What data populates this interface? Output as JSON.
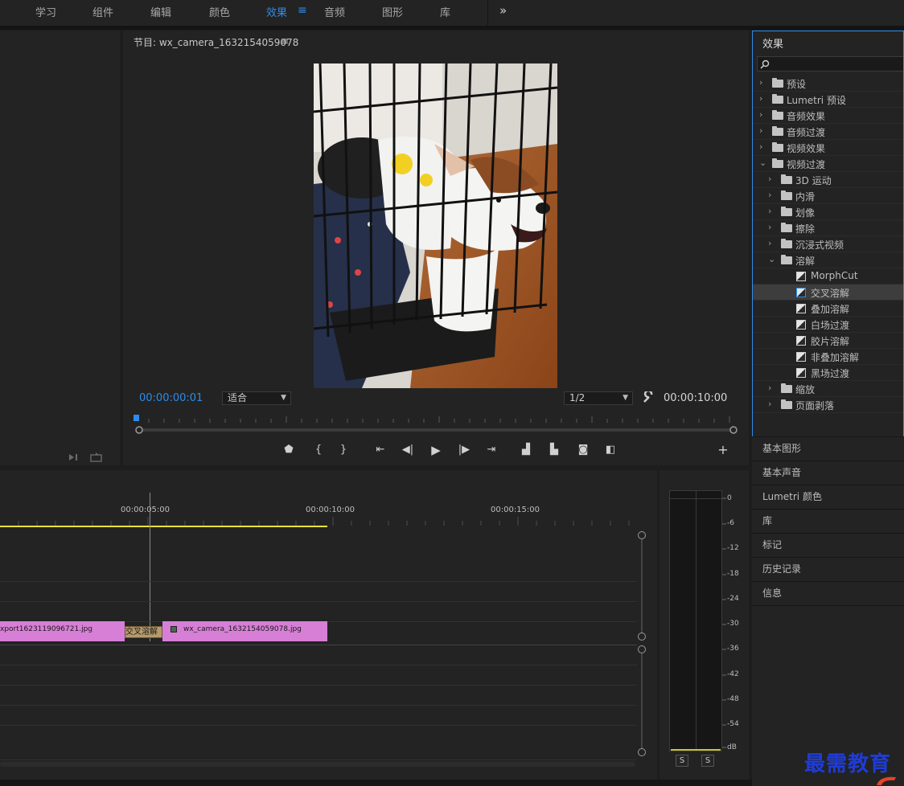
{
  "workspace_tabs": [
    "学习",
    "组件",
    "编辑",
    "颜色",
    "效果",
    "音频",
    "图形",
    "库"
  ],
  "active_tab": "效果",
  "program_monitor": {
    "title": "节目: wx_camera_1632154059078",
    "timecode_current": "00:00:00:01",
    "fit": "适合",
    "resolution": "1/2",
    "timecode_duration": "00:00:10:00"
  },
  "effects_panel": {
    "title": "效果",
    "search_placeholder": "",
    "tree": [
      {
        "label": "预设",
        "level": 0,
        "kind": "folder-star",
        "expanded": false
      },
      {
        "label": "Lumetri 预设",
        "level": 0,
        "kind": "folder-star",
        "expanded": false
      },
      {
        "label": "音频效果",
        "level": 0,
        "kind": "folder",
        "expanded": false
      },
      {
        "label": "音频过渡",
        "level": 0,
        "kind": "folder",
        "expanded": false
      },
      {
        "label": "视频效果",
        "level": 0,
        "kind": "folder",
        "expanded": false
      },
      {
        "label": "视频过渡",
        "level": 0,
        "kind": "folder",
        "expanded": true
      },
      {
        "label": "3D 运动",
        "level": 1,
        "kind": "folder",
        "expanded": false
      },
      {
        "label": "内滑",
        "level": 1,
        "kind": "folder",
        "expanded": false
      },
      {
        "label": "划像",
        "level": 1,
        "kind": "folder",
        "expanded": false
      },
      {
        "label": "擦除",
        "level": 1,
        "kind": "folder",
        "expanded": false
      },
      {
        "label": "沉浸式视频",
        "level": 1,
        "kind": "folder",
        "expanded": false
      },
      {
        "label": "溶解",
        "level": 1,
        "kind": "folder",
        "expanded": true
      },
      {
        "label": "MorphCut",
        "level": 2,
        "kind": "transition"
      },
      {
        "label": "交叉溶解",
        "level": 2,
        "kind": "transition",
        "selected": true
      },
      {
        "label": "叠加溶解",
        "level": 2,
        "kind": "transition"
      },
      {
        "label": "白场过渡",
        "level": 2,
        "kind": "transition"
      },
      {
        "label": "胶片溶解",
        "level": 2,
        "kind": "transition"
      },
      {
        "label": "非叠加溶解",
        "level": 2,
        "kind": "transition"
      },
      {
        "label": "黑场过渡",
        "level": 2,
        "kind": "transition"
      },
      {
        "label": "缩放",
        "level": 1,
        "kind": "folder",
        "expanded": false
      },
      {
        "label": "页面剥落",
        "level": 1,
        "kind": "folder",
        "expanded": false
      }
    ]
  },
  "side_panels": [
    "基本图形",
    "基本声音",
    "Lumetri 颜色",
    "库",
    "标记",
    "历史记录",
    "信息"
  ],
  "timeline": {
    "ruler": [
      "00:00:05:00",
      "00:00:10:00",
      "00:00:15:00"
    ],
    "clips": [
      {
        "name": "xport1623119096721.jpg"
      },
      {
        "name": "wx_camera_1632154059078.jpg"
      }
    ],
    "transition_label": "交叉溶解"
  },
  "audio_meter": {
    "scale": [
      "0",
      "-6",
      "-12",
      "-18",
      "-24",
      "-30",
      "-36",
      "-42",
      "-48",
      "-54",
      "dB"
    ],
    "solo": [
      "S",
      "S"
    ]
  },
  "watermark": "最需教育",
  "colors": {
    "accent": "#2d8ceb",
    "clip": "#d77fd6",
    "transition": "#b59a6a",
    "work_area": "#e8e13a"
  },
  "icons": [
    "menu-icon",
    "overflow-chevron-icon",
    "search-icon",
    "folder-icon",
    "folder-star-icon",
    "transition-icon",
    "wrench-icon",
    "add-marker-icon",
    "mark-in-icon",
    "mark-out-icon",
    "go-to-in-icon",
    "step-back-icon",
    "play-icon",
    "step-forward-icon",
    "go-to-out-icon",
    "lift-icon",
    "extract-icon",
    "camera-icon",
    "compare-icon",
    "plus-icon"
  ]
}
